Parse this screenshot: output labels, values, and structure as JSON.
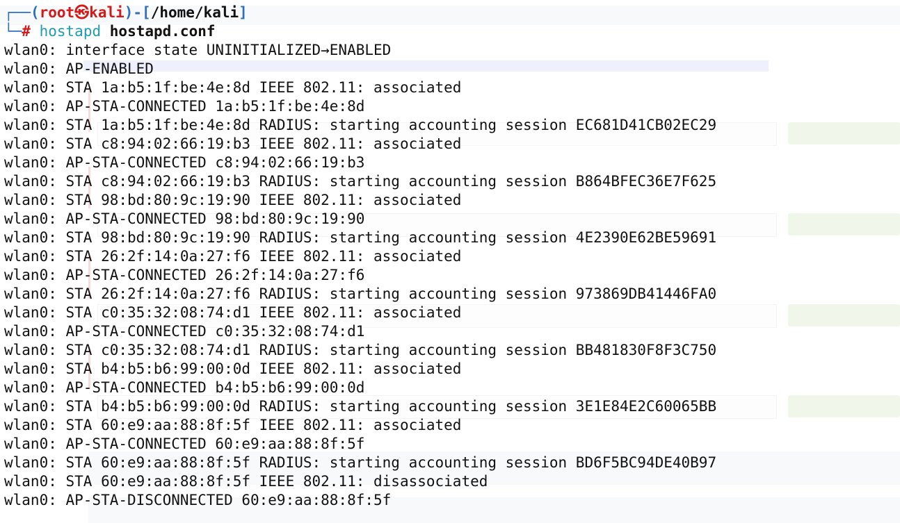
{
  "prompt": {
    "user": "root",
    "skull": "㉿",
    "host": "kali",
    "cwd": "/home/kali",
    "hash": "#",
    "command": "hostapd",
    "argument": "hostapd.conf"
  },
  "output_lines": [
    "wlan0: interface state UNINITIALIZED→ENABLED",
    "wlan0: AP-ENABLED",
    "wlan0: STA 1a:b5:1f:be:4e:8d IEEE 802.11: associated",
    "wlan0: AP-STA-CONNECTED 1a:b5:1f:be:4e:8d",
    "wlan0: STA 1a:b5:1f:be:4e:8d RADIUS: starting accounting session EC681D41CB02EC29",
    "wlan0: STA c8:94:02:66:19:b3 IEEE 802.11: associated",
    "wlan0: AP-STA-CONNECTED c8:94:02:66:19:b3",
    "wlan0: STA c8:94:02:66:19:b3 RADIUS: starting accounting session B864BFEC36E7F625",
    "wlan0: STA 98:bd:80:9c:19:90 IEEE 802.11: associated",
    "wlan0: AP-STA-CONNECTED 98:bd:80:9c:19:90",
    "wlan0: STA 98:bd:80:9c:19:90 RADIUS: starting accounting session 4E2390E62BE59691",
    "wlan0: STA 26:2f:14:0a:27:f6 IEEE 802.11: associated",
    "wlan0: AP-STA-CONNECTED 26:2f:14:0a:27:f6",
    "wlan0: STA 26:2f:14:0a:27:f6 RADIUS: starting accounting session 973869DB41446FA0",
    "wlan0: STA c0:35:32:08:74:d1 IEEE 802.11: associated",
    "wlan0: AP-STA-CONNECTED c0:35:32:08:74:d1",
    "wlan0: STA c0:35:32:08:74:d1 RADIUS: starting accounting session BB481830F8F3C750",
    "wlan0: STA b4:b5:b6:99:00:0d IEEE 802.11: associated",
    "wlan0: AP-STA-CONNECTED b4:b5:b6:99:00:0d",
    "wlan0: STA b4:b5:b6:99:00:0d RADIUS: starting accounting session 3E1E84E2C60065BB",
    "wlan0: STA 60:e9:aa:88:8f:5f IEEE 802.11: associated",
    "wlan0: AP-STA-CONNECTED 60:e9:aa:88:8f:5f",
    "wlan0: STA 60:e9:aa:88:8f:5f RADIUS: starting accounting session BD6F5BC94DE40B97",
    "wlan0: STA 60:e9:aa:88:8f:5f IEEE 802.11: disassociated",
    "wlan0: AP-STA-DISCONNECTED 60:e9:aa:88:8f:5f"
  ],
  "colors": {
    "prompt_frame": "#2f6fc2",
    "prompt_user": "#d21a1a",
    "command": "#1f9bb5",
    "text": "#111111",
    "background": "#ffffff"
  }
}
